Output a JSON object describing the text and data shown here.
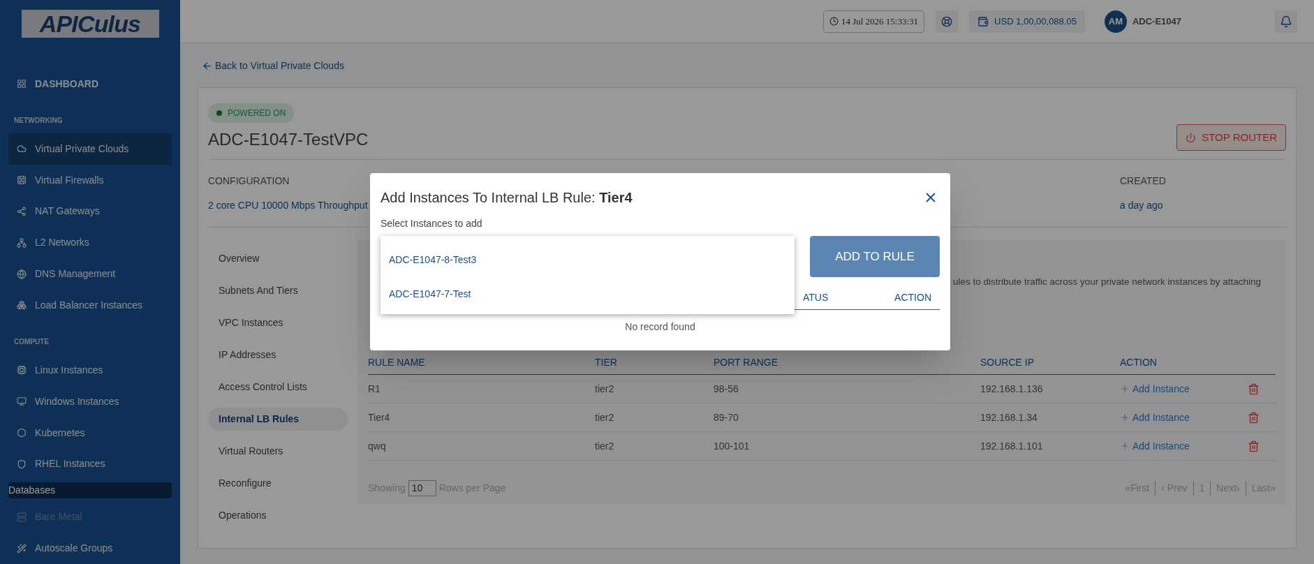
{
  "sidebar": {
    "logo": "APICulus",
    "items": [
      {
        "kind": "link",
        "label": "DASHBOARD",
        "selected": false,
        "disabled": false
      },
      {
        "kind": "section",
        "label": "NETWORKING"
      },
      {
        "kind": "link",
        "label": "Virtual Private Clouds",
        "selected": true,
        "disabled": false
      },
      {
        "kind": "link",
        "label": "Virtual Firewalls",
        "selected": false,
        "disabled": false
      },
      {
        "kind": "link",
        "label": "NAT Gateways",
        "selected": false,
        "disabled": false
      },
      {
        "kind": "link",
        "label": "L2 Networks",
        "selected": false,
        "disabled": false
      },
      {
        "kind": "link",
        "label": "DNS Management",
        "selected": false,
        "disabled": false
      },
      {
        "kind": "link",
        "label": "Load Balancer Instances",
        "selected": false,
        "disabled": false
      },
      {
        "kind": "section",
        "label": "COMPUTE"
      },
      {
        "kind": "link",
        "label": "Linux Instances",
        "selected": false,
        "disabled": false
      },
      {
        "kind": "link",
        "label": "Windows Instances",
        "selected": false,
        "disabled": false
      },
      {
        "kind": "link",
        "label": "Kubernetes",
        "selected": false,
        "disabled": false
      },
      {
        "kind": "link",
        "label": "RHEL Instances",
        "selected": false,
        "disabled": false
      },
      {
        "kind": "group",
        "label": "Databases"
      },
      {
        "kind": "link",
        "label": "Bare Metal",
        "selected": false,
        "disabled": true
      },
      {
        "kind": "link",
        "label": "Autoscale Groups",
        "selected": false,
        "disabled": false
      }
    ]
  },
  "topbar": {
    "datetime": "14 Jul 2026 15:33:31",
    "balance": "USD 1,00,00,088.05",
    "avatar": "AM",
    "user": "ADC-E1047"
  },
  "back_link": "Back to Virtual Private Clouds",
  "vpc": {
    "status": "POWERED ON",
    "powered_on": true,
    "name": "ADC-E1047-TestVPC",
    "stop_button": "STOP ROUTER",
    "details": [
      {
        "label": "CONFIGURATION",
        "value": "2 core CPU 10000 Mbps Throughput"
      },
      {
        "label": "CREATED",
        "value": "a day ago"
      }
    ]
  },
  "tabs": [
    {
      "label": "Overview",
      "selected": false
    },
    {
      "label": "Subnets And Tiers",
      "selected": false
    },
    {
      "label": "VPC Instances",
      "selected": false
    },
    {
      "label": "IP Addresses",
      "selected": false
    },
    {
      "label": "Access Control Lists",
      "selected": false
    },
    {
      "label": "Internal LB Rules",
      "selected": true
    },
    {
      "label": "Virtual Routers",
      "selected": false
    },
    {
      "label": "Reconfigure",
      "selected": false
    },
    {
      "label": "Operations",
      "selected": false
    }
  ],
  "description_fragment": "ules to distribute traffic across your private network instances by attaching",
  "table": {
    "columns": [
      "RULE NAME",
      "TIER",
      "PORT RANGE",
      "SOURCE IP",
      "ACTION"
    ],
    "rows": [
      {
        "cells": [
          "R1",
          "tier2",
          "98-56",
          "192.168.1.136"
        ],
        "action": "Add Instance"
      },
      {
        "cells": [
          "Tier4",
          "tier2",
          "89-70",
          "192.168.1.34"
        ],
        "action": "Add Instance"
      },
      {
        "cells": [
          "qwq",
          "tier2",
          "100-101",
          "192.168.1.101"
        ],
        "action": "Add Instance"
      }
    ]
  },
  "pagination": {
    "showing": "Showing",
    "rows": "10",
    "per_page": "Rows per Page",
    "first": "«First",
    "prev": "‹ Prev",
    "page": "1",
    "next": "Next›",
    "last": "Last»"
  },
  "modal": {
    "title": "Add Instances To Internal LB Rule: **Tier4**",
    "field_label": "Select Instances to add",
    "options": [
      "ADC-E1047-8-Test3",
      "ADC-E1047-7-Test"
    ],
    "button": "ADD TO RULE",
    "columns": [
      "ATUS",
      "ACTION"
    ],
    "empty": "No record found"
  }
}
